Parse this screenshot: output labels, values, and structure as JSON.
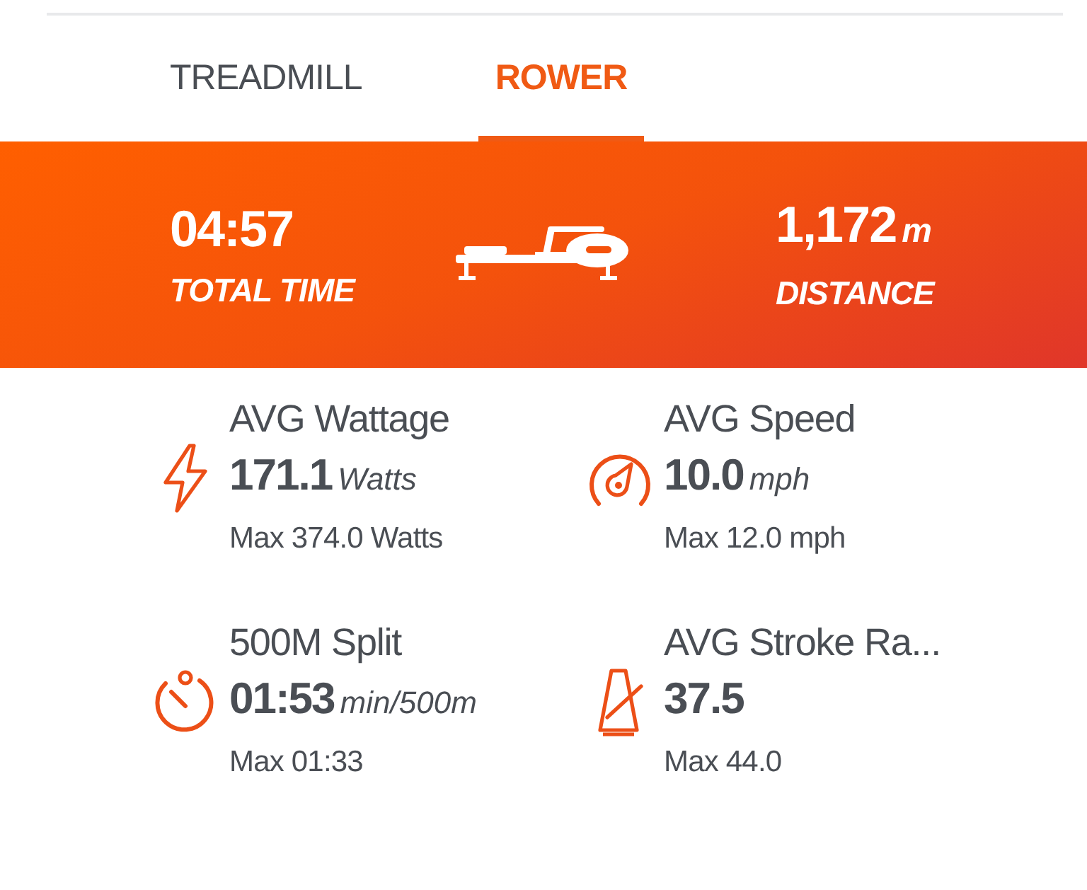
{
  "tabs": [
    {
      "label": "TREADMILL",
      "selected": false
    },
    {
      "label": "ROWER",
      "selected": true
    }
  ],
  "summary": {
    "total_time": {
      "value": "04:57",
      "label": "TOTAL TIME"
    },
    "distance": {
      "value": "1,172",
      "unit": "m",
      "label": "DISTANCE"
    }
  },
  "stats": [
    {
      "title": "AVG Wattage",
      "value": "171.1",
      "unit": "Watts",
      "max": "Max 374.0 Watts"
    },
    {
      "title": "AVG Speed",
      "value": "10.0",
      "unit": "mph",
      "max": "Max 12.0 mph"
    },
    {
      "title": "500M Split",
      "value": "01:53",
      "unit": "min/500m",
      "max": "Max 01:33"
    },
    {
      "title": "AVG Stroke Ra...",
      "value": "37.5",
      "max": "Max 44.0"
    }
  ]
}
